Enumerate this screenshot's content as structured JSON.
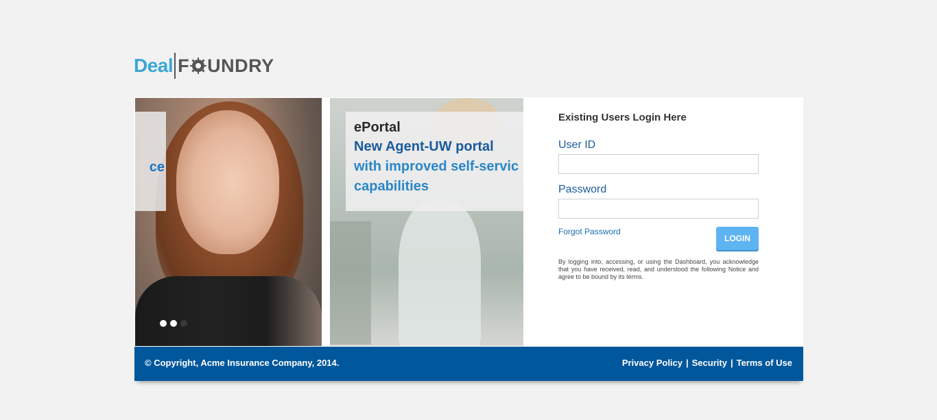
{
  "brand": {
    "part1": "Deal",
    "part2_pre": "F",
    "part2_post": "UNDRY"
  },
  "carousel": {
    "slide1_fragment": "ce",
    "slide2": {
      "title": "ePortal",
      "line1": "New Agent-UW portal",
      "line2": "with improved self-servic",
      "line3": "capabilities"
    },
    "active_slide": 2,
    "total_slides": 3
  },
  "login": {
    "heading": "Existing Users Login Here",
    "user_id_label": "User ID",
    "user_id_value": "",
    "password_label": "Password",
    "password_value": "",
    "forgot_label": "Forgot Password",
    "button_label": "LOGIN",
    "notice": "By logging into, accessing, or using the Dashboard, you acknowledge that you have received, read, and understood the following Notice and agree to be bound by its terms."
  },
  "footer": {
    "copyright": "© Copyright, Acme Insurance Company, 2014.",
    "privacy": "Privacy Policy",
    "security": "Security",
    "terms": "Terms of Use",
    "sep": "|"
  },
  "colors": {
    "accent": "#00579b",
    "button": "#5eb3f1",
    "brand_blue": "#3aa6d8"
  }
}
